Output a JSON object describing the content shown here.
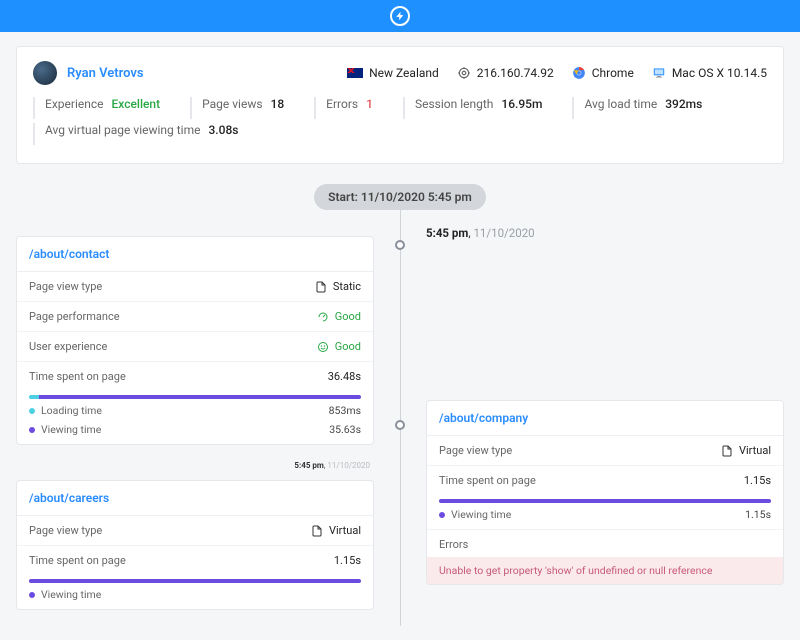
{
  "header": {
    "logo": "bolt"
  },
  "user": {
    "name": "Ryan Vetrovs"
  },
  "meta": {
    "country": "New Zealand",
    "ip": "216.160.74.92",
    "browser": "Chrome",
    "os": "Mac OS X 10.14.5"
  },
  "stats": {
    "experience_label": "Experience",
    "experience_val": "Excellent",
    "pageviews_label": "Page views",
    "pageviews_val": "18",
    "errors_label": "Errors",
    "errors_val": "1",
    "session_label": "Session length",
    "session_val": "16.95m",
    "avgload_label": "Avg load time",
    "avgload_val": "392ms",
    "avgvirtual_label": "Avg virtual page viewing time",
    "avgvirtual_val": "3.08s"
  },
  "timeline": {
    "start_chip": "Start: 11/10/2020 5:45 pm",
    "ts_time": "5:45 pm",
    "ts_date": "11/10/2020"
  },
  "cards": {
    "contact": {
      "path": "/about/contact",
      "pvt_label": "Page view type",
      "pvt_val": "Static",
      "perf_label": "Page performance",
      "perf_val": "Good",
      "ux_label": "User experience",
      "ux_val": "Good",
      "time_label": "Time spent on page",
      "time_val": "36.48s",
      "loading_label": "Loading time",
      "loading_val": "853ms",
      "viewing_label": "Viewing time",
      "viewing_val": "35.63s"
    },
    "careers": {
      "path": "/about/careers",
      "pvt_label": "Page view type",
      "pvt_val": "Virtual",
      "time_label": "Time spent on page",
      "time_val": "1.15s",
      "viewing_label": "Viewing time"
    },
    "company": {
      "path": "/about/company",
      "pvt_label": "Page view type",
      "pvt_val": "Virtual",
      "time_label": "Time spent on page",
      "time_val": "1.15s",
      "viewing_label": "Viewing time",
      "viewing_val": "1.15s",
      "errors_label": "Errors",
      "error_msg": "Unable to get property 'show' of undefined or null reference"
    }
  }
}
